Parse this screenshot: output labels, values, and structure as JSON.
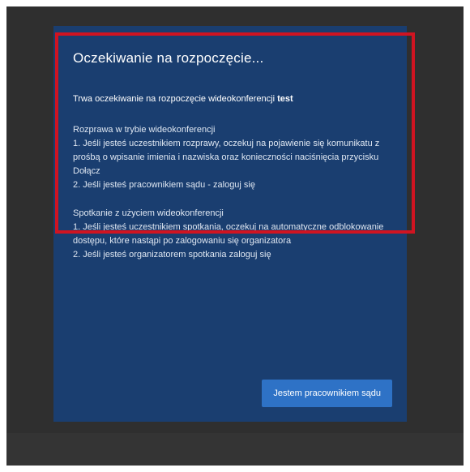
{
  "dialog": {
    "title": "Oczekiwanie na rozpoczęcie...",
    "status_prefix": "Trwa oczekiwanie na rozpoczęcie wideokonferencji",
    "status_name": "test",
    "section1": {
      "heading": "Rozprawa w trybie wideokonferencji",
      "line1": "1. Jeśli jesteś uczestnikiem rozprawy, oczekuj na pojawienie się komunikatu z prośbą o wpisanie imienia i nazwiska oraz konieczności naciśnięcia przycisku Dołącz",
      "line2": "2. Jeśli jesteś pracownikiem sądu - zaloguj się"
    },
    "section2": {
      "heading": "Spotkanie z użyciem wideokonferencji",
      "line1": "1. Jeśli jesteś uczestnikiem spotkania, oczekuj na automatyczne odblokowanie dostępu, które nastąpi po zalogowaniu się organizatora",
      "line2": "2. Jeśli jesteś organizatorem spotkania zaloguj się"
    },
    "button_label": "Jestem pracownikiem sądu"
  },
  "colors": {
    "dialog_bg": "#1a3e70",
    "backdrop": "#2f2f2f",
    "button": "#2e72c6",
    "highlight": "#d01421"
  }
}
